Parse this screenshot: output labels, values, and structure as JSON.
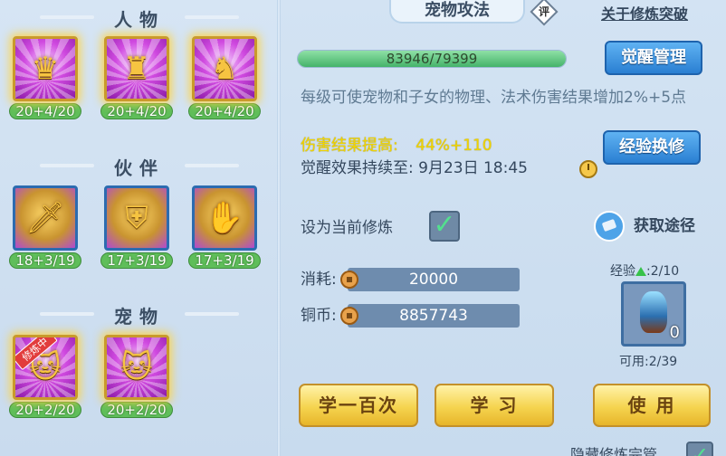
{
  "sections": {
    "person": "人物",
    "partner": "伙伴",
    "pet": "宠物"
  },
  "person_cards": [
    {
      "level": "20+4/20",
      "icon": "dragon-helmet-cultivation-icon"
    },
    {
      "level": "20+4/20",
      "icon": "dragon-armor-cultivation-icon"
    },
    {
      "level": "20+4/20",
      "icon": "dragon-warrior-cultivation-icon"
    }
  ],
  "partner_cards": [
    {
      "level": "18+3/19",
      "icon": "sword-lion-cultivation-icon"
    },
    {
      "level": "17+3/19",
      "icon": "shield-lion-cultivation-icon"
    },
    {
      "level": "17+3/19",
      "icon": "claw-lion-cultivation-icon"
    }
  ],
  "pet_cards": [
    {
      "level": "20+2/20",
      "icon": "pet-attack-cultivation-icon",
      "badge": "修炼中"
    },
    {
      "level": "20+2/20",
      "icon": "pet-defense-cultivation-icon"
    }
  ],
  "header": {
    "title": "宠物攻法",
    "rating_badge": "评",
    "breakthrough_link": "关于修炼突破"
  },
  "progress": {
    "text": "83946/79399",
    "fraction": 1.0
  },
  "buttons": {
    "awaken_manage": "觉醒管理",
    "exp_exchange": "经验换修",
    "learn_hundred": "学一百次",
    "learn": "学 习",
    "use": "使 用"
  },
  "description": "每级可使宠物和子女的物理、法术伤害结果增加2%+5点",
  "damage": {
    "label": "伤害结果提高:",
    "value": "44%+110"
  },
  "awaken_duration": {
    "label": "觉醒效果持续至:",
    "value": "9月23日 18:45"
  },
  "set_current": {
    "label": "设为当前修炼",
    "checked": true
  },
  "get_path": "获取途径",
  "cost": {
    "label": "消耗:",
    "value": "20000"
  },
  "copper": {
    "label": "铜币:",
    "value": "8857743"
  },
  "exp": {
    "label": "经验",
    "value": ":2/10"
  },
  "item": {
    "count": "0",
    "available": "可用:2/39"
  },
  "bottom": {
    "hide_label": "隐藏修炼完管"
  },
  "colors": {
    "accent_yellow": "#f0d400",
    "button_blue": "#2a7fd2",
    "progress_green": "#45b36a"
  }
}
